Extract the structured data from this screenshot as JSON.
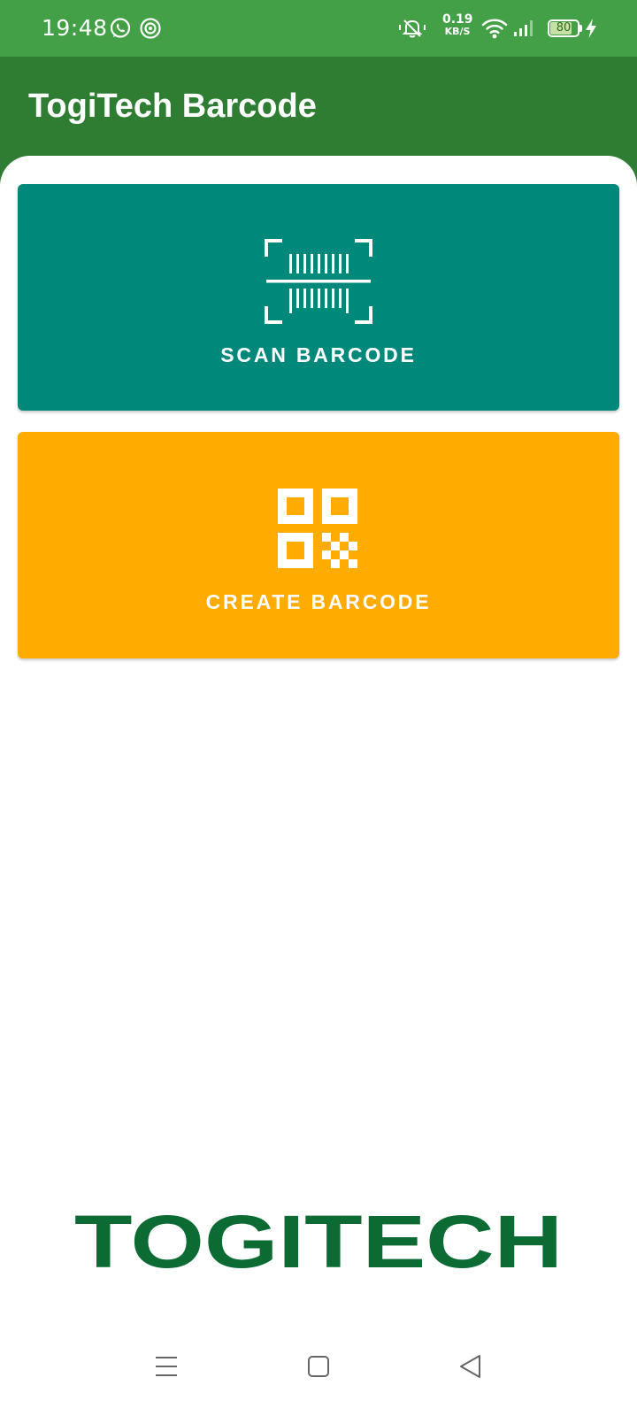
{
  "status_bar": {
    "time": "19:48",
    "net_speed_value": "0.19",
    "net_speed_unit": "KB/S",
    "battery_level": "80",
    "battery_fraction": 0.8,
    "icons": [
      "whatsapp-icon",
      "app-notification-icon",
      "muted-bell-icon",
      "wifi-icon",
      "signal-icon",
      "battery-icon",
      "charging-icon"
    ]
  },
  "app_bar": {
    "title": "TogiTech Barcode"
  },
  "actions": {
    "scan": {
      "label": "SCAN BARCODE",
      "icon": "barcode-scan-icon",
      "color": "#00897b"
    },
    "create": {
      "label": "CREATE BARCODE",
      "icon": "qr-code-icon",
      "color": "#ffab00"
    }
  },
  "brand": {
    "logo_text": "TOGITECH",
    "color": "#0b6b33"
  },
  "nav_bar": {
    "icons": [
      "menu-icon",
      "home-icon",
      "back-icon"
    ]
  },
  "colors": {
    "status_bar": "#43a047",
    "app_bar": "#2e7d32",
    "background": "#ffffff"
  }
}
